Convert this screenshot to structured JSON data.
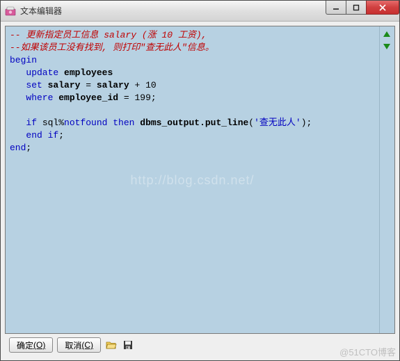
{
  "window": {
    "title": "文本编辑器"
  },
  "code": {
    "line1": "-- 更新指定员工信息 salary (涨 10 工资),",
    "line2": "--如果该员工没有找到, 则打印\"查无此人\"信息。",
    "kw_begin": "begin",
    "kw_update": "update",
    "tbl_employees": "employees",
    "kw_set": "set",
    "col_salary": "salary",
    "eq": " = ",
    "plus": " + ",
    "num_10": "10",
    "kw_where": "where",
    "col_empid": "employee_id",
    "num_199": "199",
    "semi": ";",
    "kw_if": "if",
    "sql_pct": " sql%",
    "kw_notfound": "notfound",
    "kw_then": " then ",
    "dbms": "dbms_output.put_line",
    "paren_open": "(",
    "str_msg": "'查无此人'",
    "paren_close": ")",
    "kw_end_if": "end if",
    "kw_end": "end"
  },
  "buttons": {
    "ok": "确定",
    "ok_key": "(O)",
    "cancel": "取消",
    "cancel_key": "(C)"
  },
  "watermark": "http://blog.csdn.net/",
  "corner": "@51CTO博客"
}
